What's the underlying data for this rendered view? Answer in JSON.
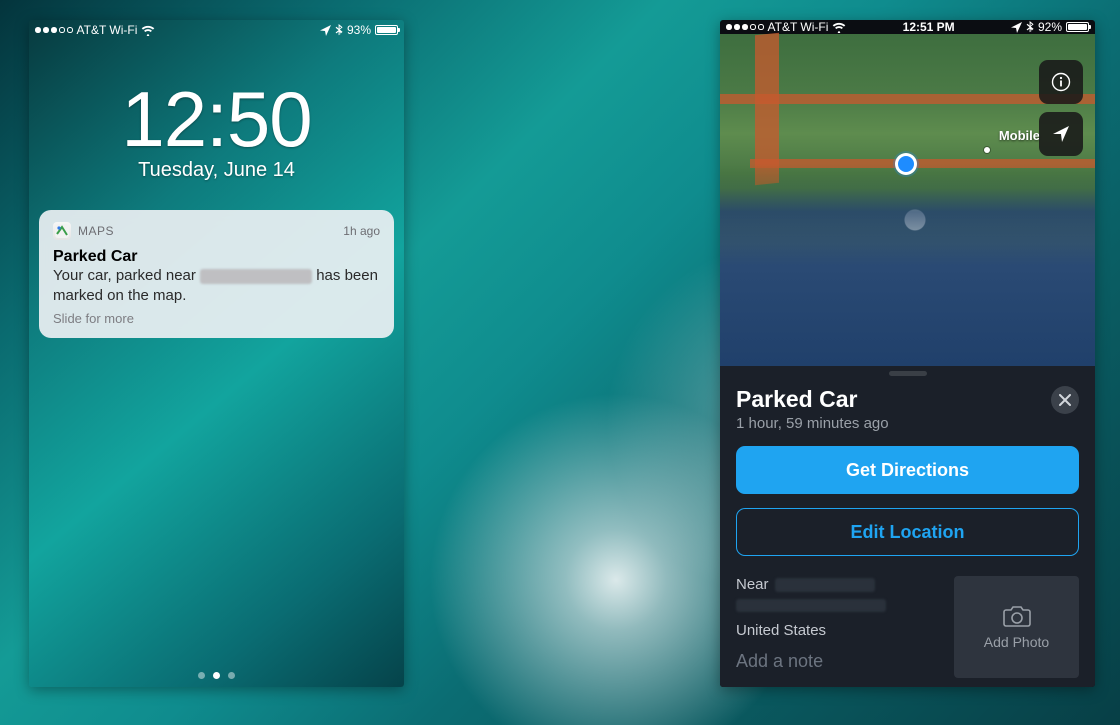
{
  "left": {
    "status": {
      "carrier": "AT&T Wi-Fi",
      "battery_pct": "93%",
      "battery_fill_pct": 93
    },
    "clock": {
      "time": "12:50",
      "date": "Tuesday, June 14"
    },
    "notif": {
      "app_name": "MAPS",
      "age": "1h ago",
      "title": "Parked Car",
      "body_before": "Your car, parked near ",
      "body_after": " has been marked on the map.",
      "slide": "Slide for more"
    }
  },
  "right": {
    "status": {
      "carrier": "AT&T Wi-Fi",
      "time": "12:51 PM",
      "battery_pct": "92%",
      "battery_fill_pct": 92
    },
    "map": {
      "city": "Mobile"
    },
    "card": {
      "title": "Parked Car",
      "sub": "1 hour, 59 minutes ago",
      "get_directions": "Get Directions",
      "edit_location": "Edit Location",
      "near_label": "Near",
      "country": "United States",
      "note_placeholder": "Add a note",
      "add_photo": "Add Photo"
    }
  }
}
